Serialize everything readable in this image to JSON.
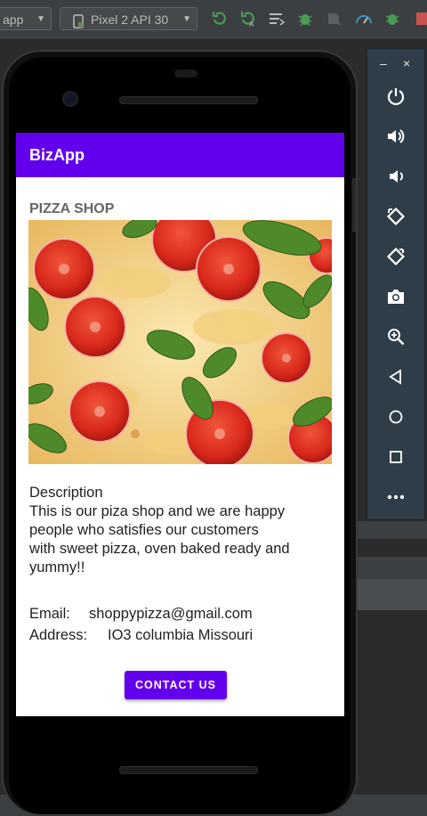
{
  "ide": {
    "run_config": "app",
    "device": "Pixel 2 API 30"
  },
  "app": {
    "title": "BizApp",
    "shop_title": "PIZZA SHOP",
    "description_heading": "Description",
    "description_lines": [
      "This is our piza shop and we are happy",
      "people who satisfies our customers",
      "with sweet pizza, oven baked ready and",
      "yummy!!"
    ],
    "email_label": "Email:",
    "email_value": "shoppypizza@gmail.com",
    "address_label": "Address:",
    "address_value": "IO3 columbia Missouri",
    "contact_button": "CONTACT US"
  },
  "emulator": {
    "minimize": "–",
    "close": "×",
    "controls": [
      "power-icon",
      "volume-up-icon",
      "volume-down-icon",
      "rotate-left-icon",
      "rotate-right-icon",
      "camera-icon",
      "zoom-icon",
      "back-icon",
      "home-icon",
      "overview-icon",
      "more-icon"
    ]
  },
  "colors": {
    "primary": "#6200ee",
    "ide_background": "#3c3f41",
    "emulator_panel": "#2e3d47"
  }
}
